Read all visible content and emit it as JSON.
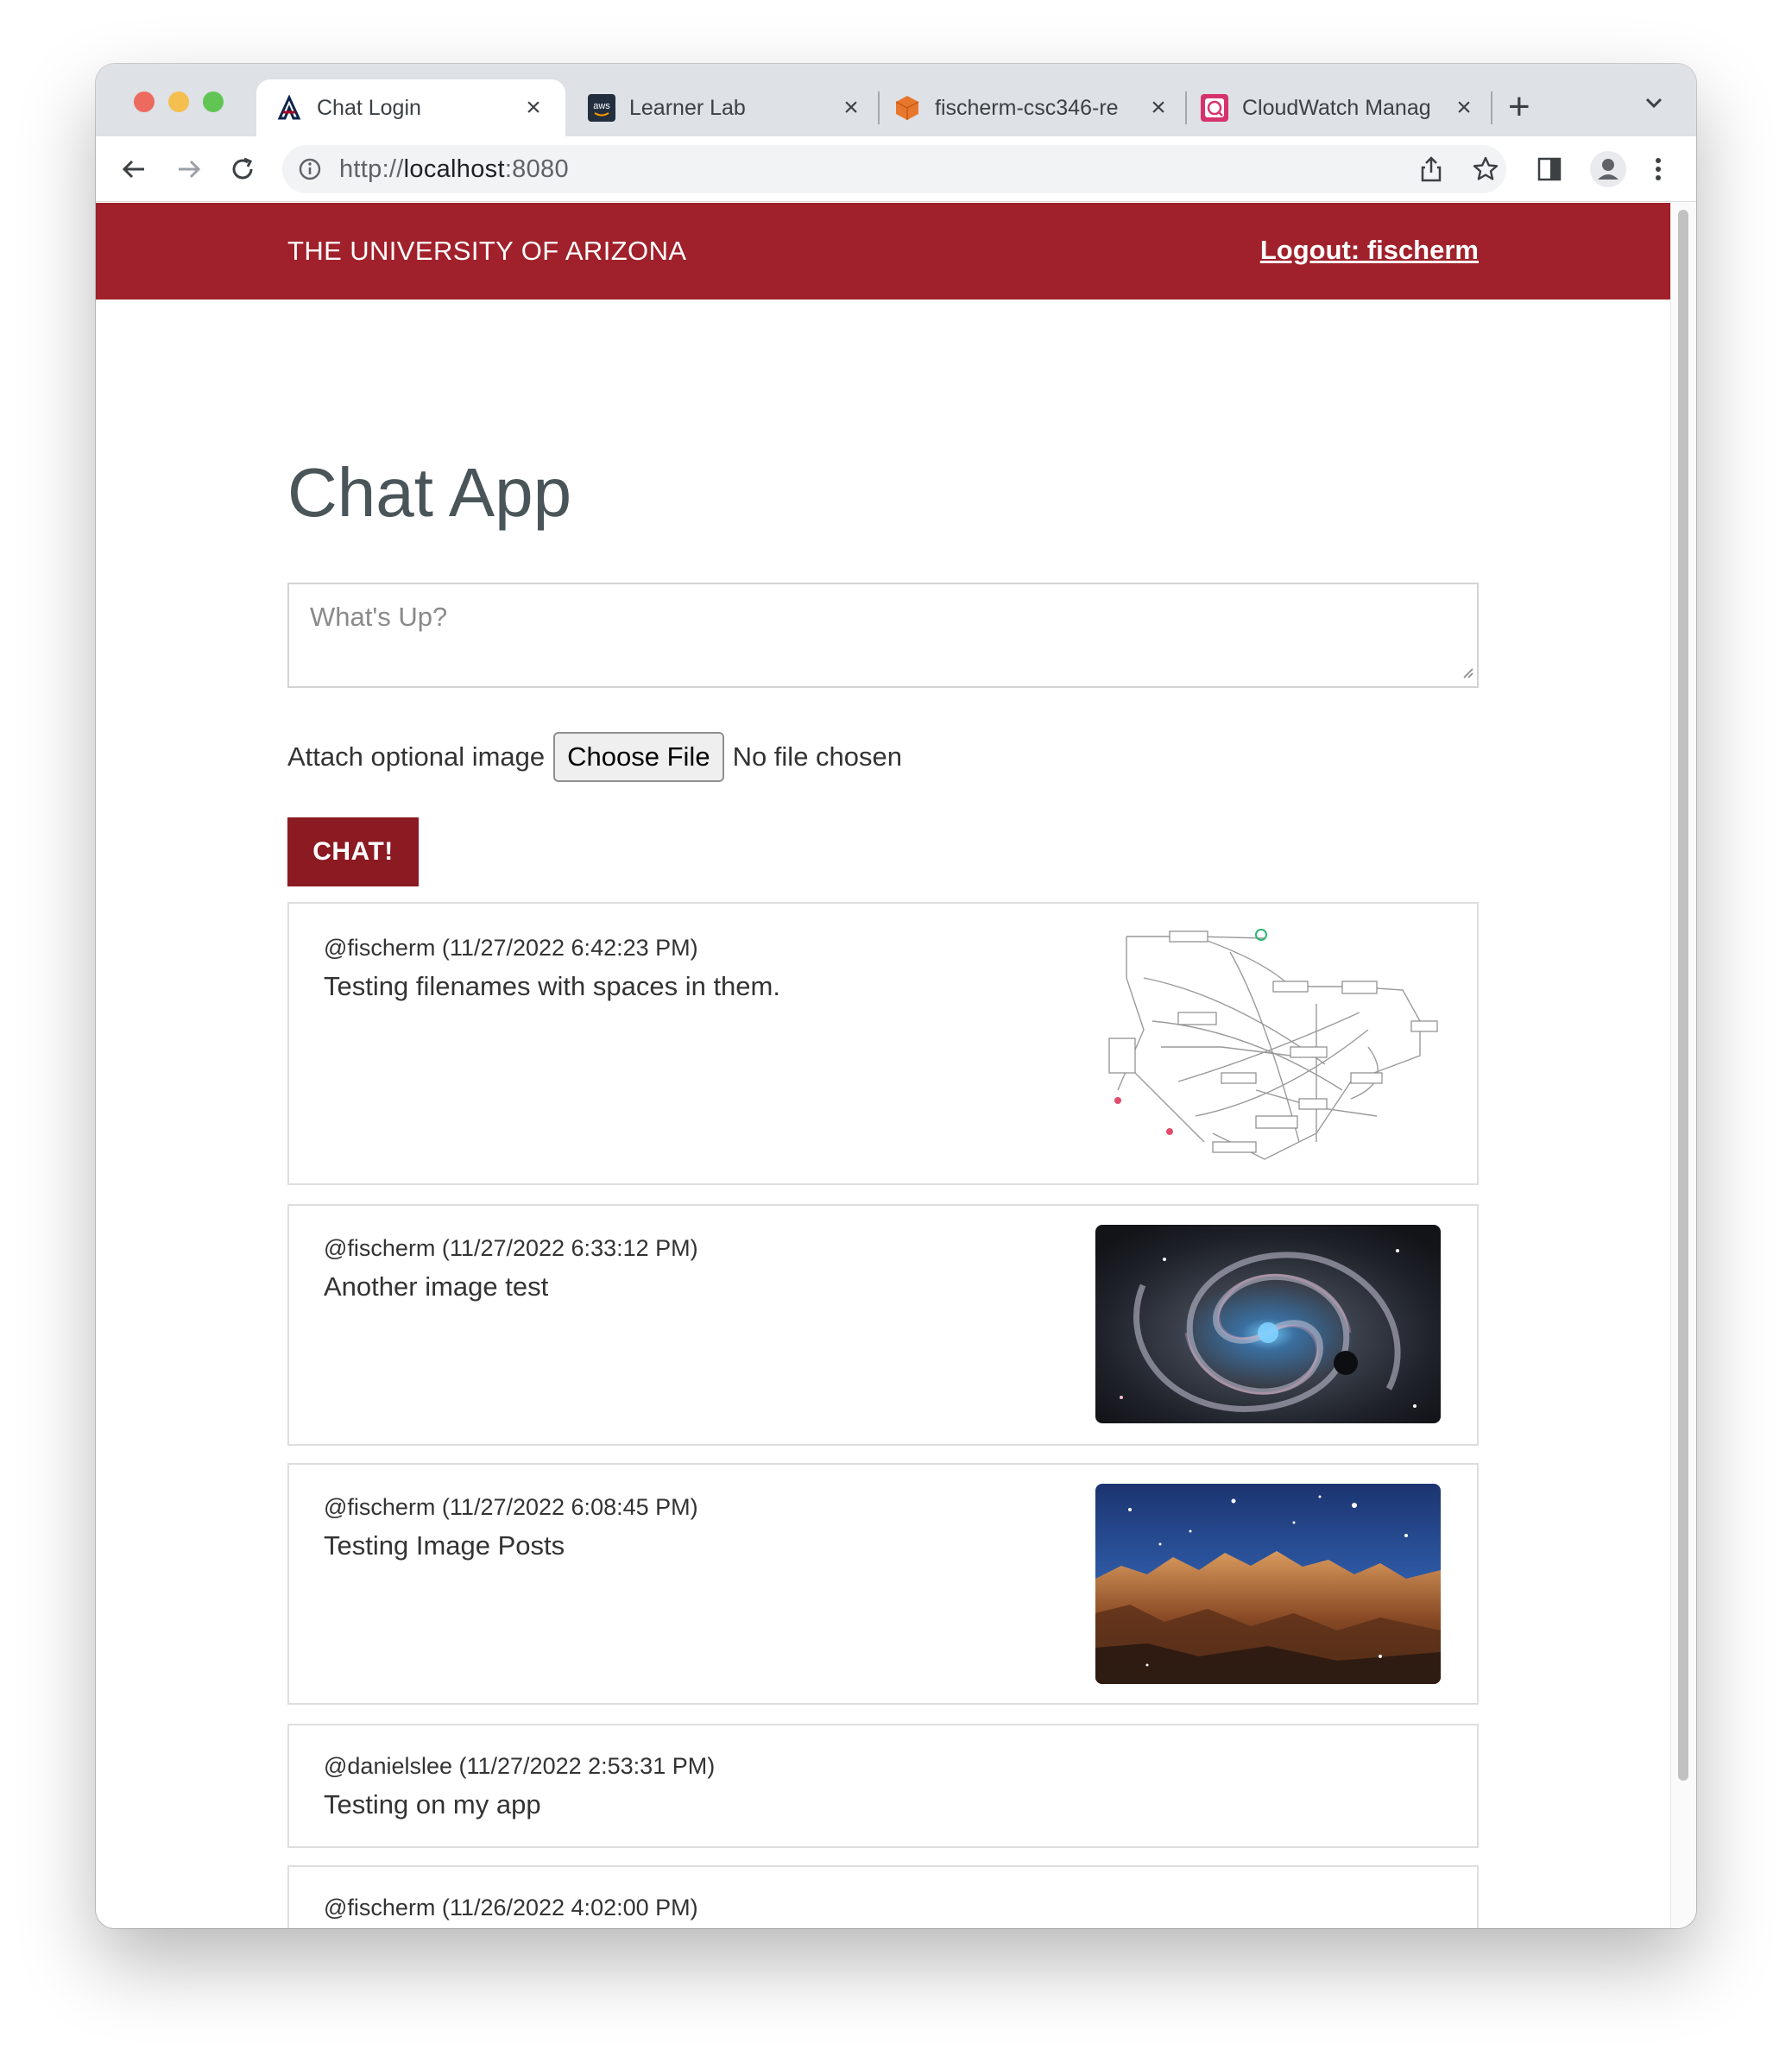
{
  "browser": {
    "tabs": [
      {
        "title": "Chat Login",
        "active": true,
        "icon": "university-of-arizona-icon"
      },
      {
        "title": "Learner Lab",
        "active": false,
        "icon": "aws-icon"
      },
      {
        "title": "fischerm-csc346-re",
        "active": false,
        "icon": "cube-icon"
      },
      {
        "title": "CloudWatch Manag",
        "active": false,
        "icon": "cloudwatch-icon"
      }
    ],
    "url_scheme": "http://",
    "url_host": "localhost",
    "url_port": ":8080"
  },
  "header": {
    "title": "THE UNIVERSITY OF ARIZONA",
    "logout": "Logout: fischerm"
  },
  "main": {
    "title": "Chat App",
    "message_placeholder": "What's Up?",
    "attach_label": "Attach optional image",
    "choose_file": "Choose File",
    "no_file": "No file chosen",
    "chat_button": "CHAT!"
  },
  "posts": [
    {
      "meta": "@fischerm (11/27/2022 6:42:23 PM)",
      "text": "Testing filenames with spaces in them.",
      "image": "diagram"
    },
    {
      "meta": "@fischerm (11/27/2022 6:33:12 PM)",
      "text": "Another image test",
      "image": "spiral-galaxy"
    },
    {
      "meta": "@fischerm (11/27/2022 6:08:45 PM)",
      "text": "Testing Image Posts",
      "image": "nebula"
    },
    {
      "meta": "@danielslee (11/27/2022 2:53:31 PM)",
      "text": "Testing on my app",
      "image": null
    },
    {
      "meta": "@fischerm (11/26/2022 4:02:00 PM)",
      "text": "",
      "image": null
    }
  ],
  "colors": {
    "brand_red": "#a0212b",
    "chat_button": "#8b1a22",
    "title_gray": "#4a5559"
  }
}
